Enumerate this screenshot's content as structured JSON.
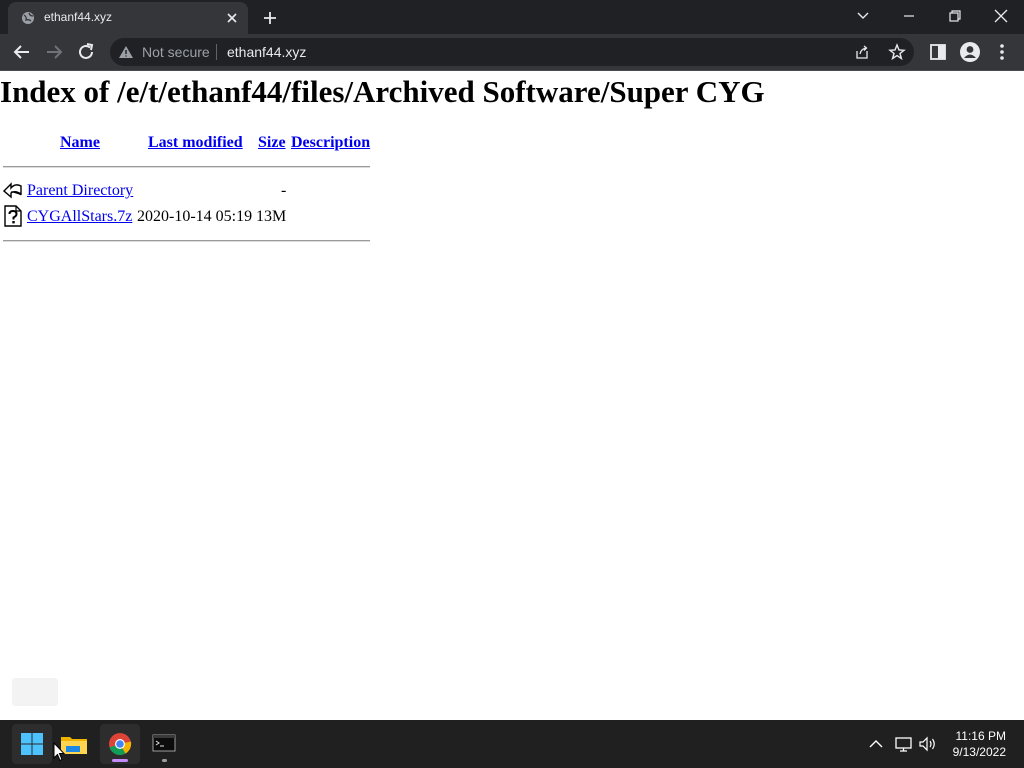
{
  "browser": {
    "tab_title": "ethanf44.xyz",
    "security_label": "Not secure",
    "url": "ethanf44.xyz"
  },
  "page": {
    "heading": "Index of /e/t/ethanf44/files/Archived Software/Super CYG",
    "columns": {
      "name": "Name",
      "last_modified": "Last modified",
      "size": "Size",
      "description": "Description"
    },
    "rows": [
      {
        "icon": "back-icon",
        "name": "Parent Directory",
        "last_modified": "",
        "size": "-",
        "description": ""
      },
      {
        "icon": "unknown-file-icon",
        "name": "CYGAllStars.7z",
        "last_modified": "2020-10-14 05:19",
        "size": "13M",
        "description": ""
      }
    ]
  },
  "taskbar": {
    "apps": [
      "start-icon",
      "file-explorer-icon",
      "chrome-icon",
      "terminal-icon"
    ],
    "time": "11:16 PM",
    "date": "9/13/2022"
  },
  "colors": {
    "link": "#0000ee",
    "chrome_dark": "#202124",
    "chrome_tab": "#35363a",
    "taskbar": "#202020"
  }
}
